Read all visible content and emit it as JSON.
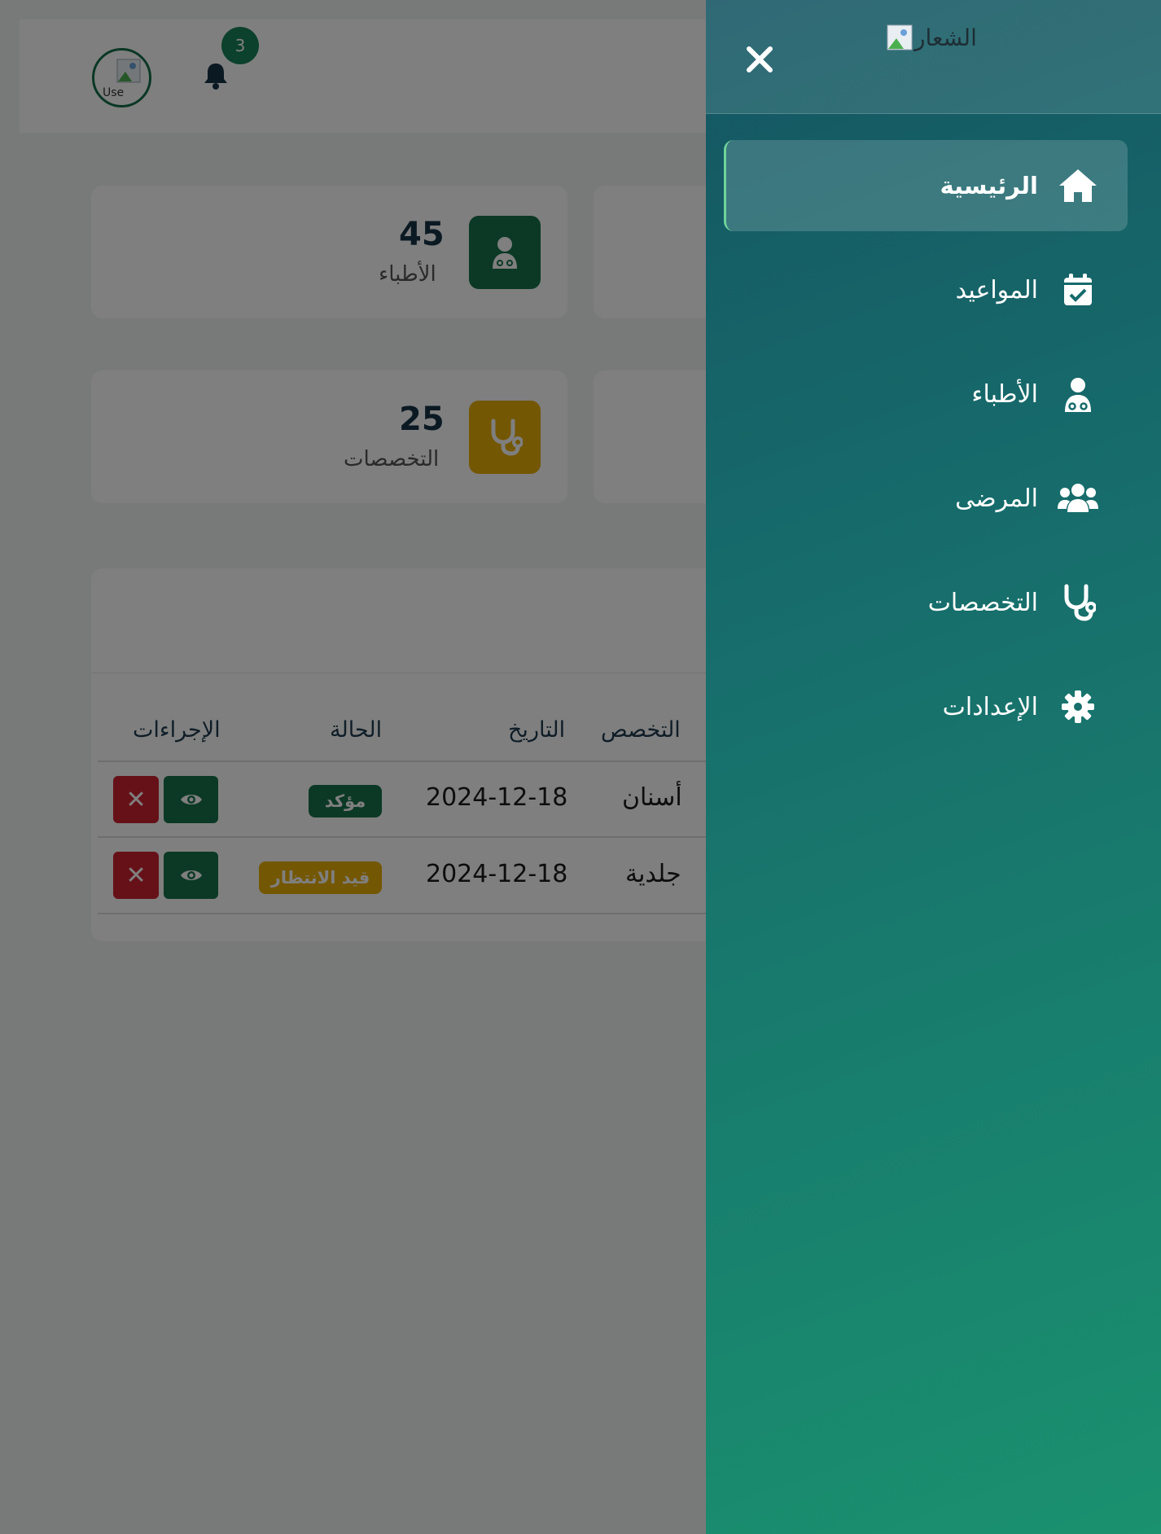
{
  "header": {
    "notifications_count": "3",
    "avatar_alt": "Use"
  },
  "stats": [
    {
      "value": "45",
      "label": "الأطباء",
      "icon": "doctor-icon",
      "color": "#16734a"
    },
    {
      "value": "25",
      "label": "التخصصات",
      "icon": "stethoscope-icon",
      "color": "#e8ae07"
    }
  ],
  "appointments_table": {
    "columns": [
      "التخصص",
      "التاريخ",
      "الحالة",
      "الإجراءات"
    ],
    "rows": [
      {
        "specialty": "أسنان",
        "date": "2024-12-18",
        "status": "مؤكد",
        "status_type": "confirmed"
      },
      {
        "specialty": "جلدية",
        "date": "2024-12-18",
        "status": "قيد الانتظار",
        "status_type": "pending"
      }
    ],
    "view_icon": "eye-icon",
    "delete_label": "✕"
  },
  "sidebar": {
    "logo_alt": "الشعار",
    "close_icon": "close-icon",
    "items": [
      {
        "label": "الرئيسية",
        "icon": "home-icon",
        "active": true
      },
      {
        "label": "المواعيد",
        "icon": "calendar-check-icon",
        "active": false
      },
      {
        "label": "الأطباء",
        "icon": "doctor-icon",
        "active": false
      },
      {
        "label": "المرضى",
        "icon": "users-icon",
        "active": false
      },
      {
        "label": "التخصصات",
        "icon": "stethoscope-icon",
        "active": false
      },
      {
        "label": "الإعدادات",
        "icon": "gear-icon",
        "active": false
      }
    ]
  },
  "colors": {
    "primary_green": "#16734a",
    "warning_yellow": "#e8ae07",
    "danger_red": "#cc2231",
    "sidebar_top": "#145562",
    "sidebar_bottom": "#1a916f"
  }
}
